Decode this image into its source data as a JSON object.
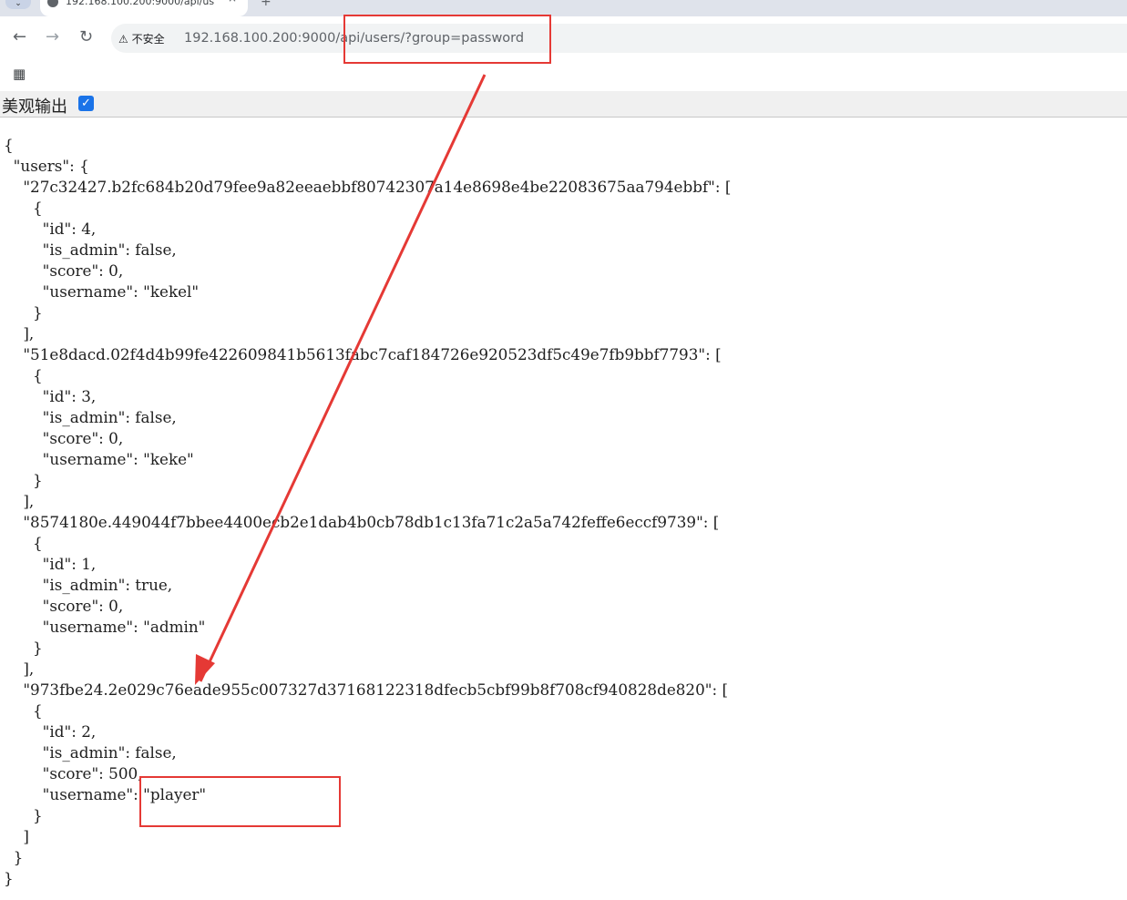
{
  "tab": {
    "title": "192.168.100.200:9000/api/us",
    "close": "×",
    "new": "+"
  },
  "toolbar": {
    "back": "←",
    "forward": "→",
    "reload": "↻",
    "insecure_label": "不安全",
    "url_host": "192.168.100.200:9000",
    "url_path": "/api/users/?group=password"
  },
  "prettyprint": {
    "label": "美观输出",
    "checked": true
  },
  "json_lines": [
    "{",
    "  \"users\": {",
    "    \"27c32427.b2fc684b20d79fee9a82eeaebbf80742307a14e8698e4be22083675aa794ebbf\": [",
    "      {",
    "        \"id\": 4,",
    "        \"is_admin\": false,",
    "        \"score\": 0,",
    "        \"username\": \"kekel\"",
    "      }",
    "    ],",
    "    \"51e8dacd.02f4d4b99fe422609841b5613fabc7caf184726e920523df5c49e7fb9bbf7793\": [",
    "      {",
    "        \"id\": 3,",
    "        \"is_admin\": false,",
    "        \"score\": 0,",
    "        \"username\": \"keke\"",
    "      }",
    "    ],",
    "    \"8574180e.449044f7bbee4400ecb2e1dab4b0cb78db1c13fa71c2a5a742feffe6eccf9739\": [",
    "      {",
    "        \"id\": 1,",
    "        \"is_admin\": true,",
    "        \"score\": 0,",
    "        \"username\": \"admin\"",
    "      }",
    "    ],",
    "    \"973fbe24.2e029c76eade955c007327d37168122318dfecb5cbf99b8f708cf940828de820\": [",
    "      {",
    "        \"id\": 2,",
    "        \"is_admin\": false,",
    "        \"score\": 500,",
    "        \"username\": \"player\"",
    "      }",
    "    ]",
    "  }",
    "}"
  ],
  "colors": {
    "annotation": "#e53935",
    "checkbox": "#1a73e8"
  }
}
